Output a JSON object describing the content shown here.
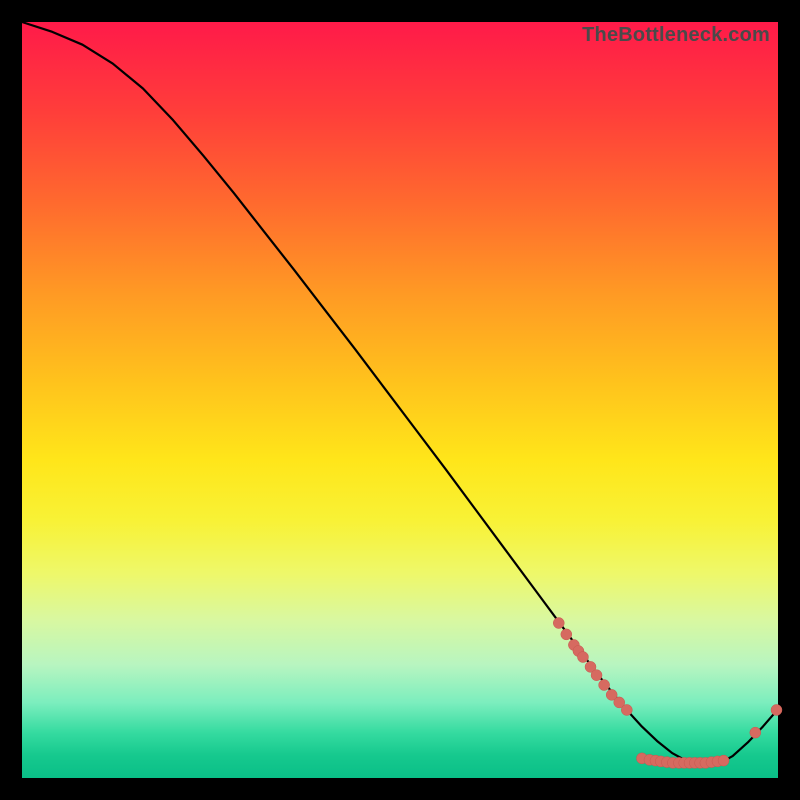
{
  "watermark": "TheBottleneck.com",
  "colors": {
    "frame_bg": "#000000",
    "curve_stroke": "#000000",
    "scatter_fill": "#d66a60",
    "scatter_stroke": "#c6584f"
  },
  "chart_data": {
    "type": "line",
    "title": "",
    "xlabel": "",
    "ylabel": "",
    "xlim": [
      0,
      100
    ],
    "ylim": [
      0,
      100
    ],
    "grid": false,
    "legend": false,
    "series": [
      {
        "name": "bottleneck-curve",
        "x": [
          0,
          4,
          8,
          12,
          16,
          20,
          24,
          28,
          32,
          36,
          40,
          44,
          48,
          52,
          56,
          60,
          64,
          68,
          72,
          76,
          78,
          80,
          82,
          84,
          86,
          88,
          90,
          92,
          94,
          96,
          98,
          100
        ],
        "y": [
          100,
          98.7,
          97.0,
          94.5,
          91.2,
          87.0,
          82.3,
          77.4,
          72.3,
          67.2,
          62.0,
          56.8,
          51.5,
          46.2,
          40.9,
          35.5,
          30.1,
          24.7,
          19.3,
          13.9,
          11.4,
          9.0,
          6.8,
          4.9,
          3.3,
          2.2,
          1.6,
          1.8,
          2.9,
          4.7,
          6.8,
          9.1
        ]
      }
    ],
    "scatter": [
      {
        "name": "markers",
        "points": [
          {
            "x": 71.0,
            "y": 20.5
          },
          {
            "x": 72.0,
            "y": 19.0
          },
          {
            "x": 73.0,
            "y": 17.6
          },
          {
            "x": 73.6,
            "y": 16.8
          },
          {
            "x": 74.2,
            "y": 16.0
          },
          {
            "x": 75.2,
            "y": 14.7
          },
          {
            "x": 76.0,
            "y": 13.6
          },
          {
            "x": 77.0,
            "y": 12.3
          },
          {
            "x": 78.0,
            "y": 11.0
          },
          {
            "x": 79.0,
            "y": 10.0
          },
          {
            "x": 80.0,
            "y": 9.0
          },
          {
            "x": 82.0,
            "y": 2.6
          },
          {
            "x": 83.0,
            "y": 2.4
          },
          {
            "x": 83.8,
            "y": 2.3
          },
          {
            "x": 84.5,
            "y": 2.2
          },
          {
            "x": 85.3,
            "y": 2.1
          },
          {
            "x": 86.1,
            "y": 2.0
          },
          {
            "x": 86.9,
            "y": 2.0
          },
          {
            "x": 87.6,
            "y": 2.0
          },
          {
            "x": 88.3,
            "y": 2.0
          },
          {
            "x": 89.0,
            "y": 2.0
          },
          {
            "x": 89.7,
            "y": 2.0
          },
          {
            "x": 90.4,
            "y": 2.0
          },
          {
            "x": 91.2,
            "y": 2.1
          },
          {
            "x": 92.0,
            "y": 2.2
          },
          {
            "x": 92.8,
            "y": 2.3
          },
          {
            "x": 97.0,
            "y": 6.0
          },
          {
            "x": 99.8,
            "y": 9.0
          }
        ]
      }
    ]
  }
}
